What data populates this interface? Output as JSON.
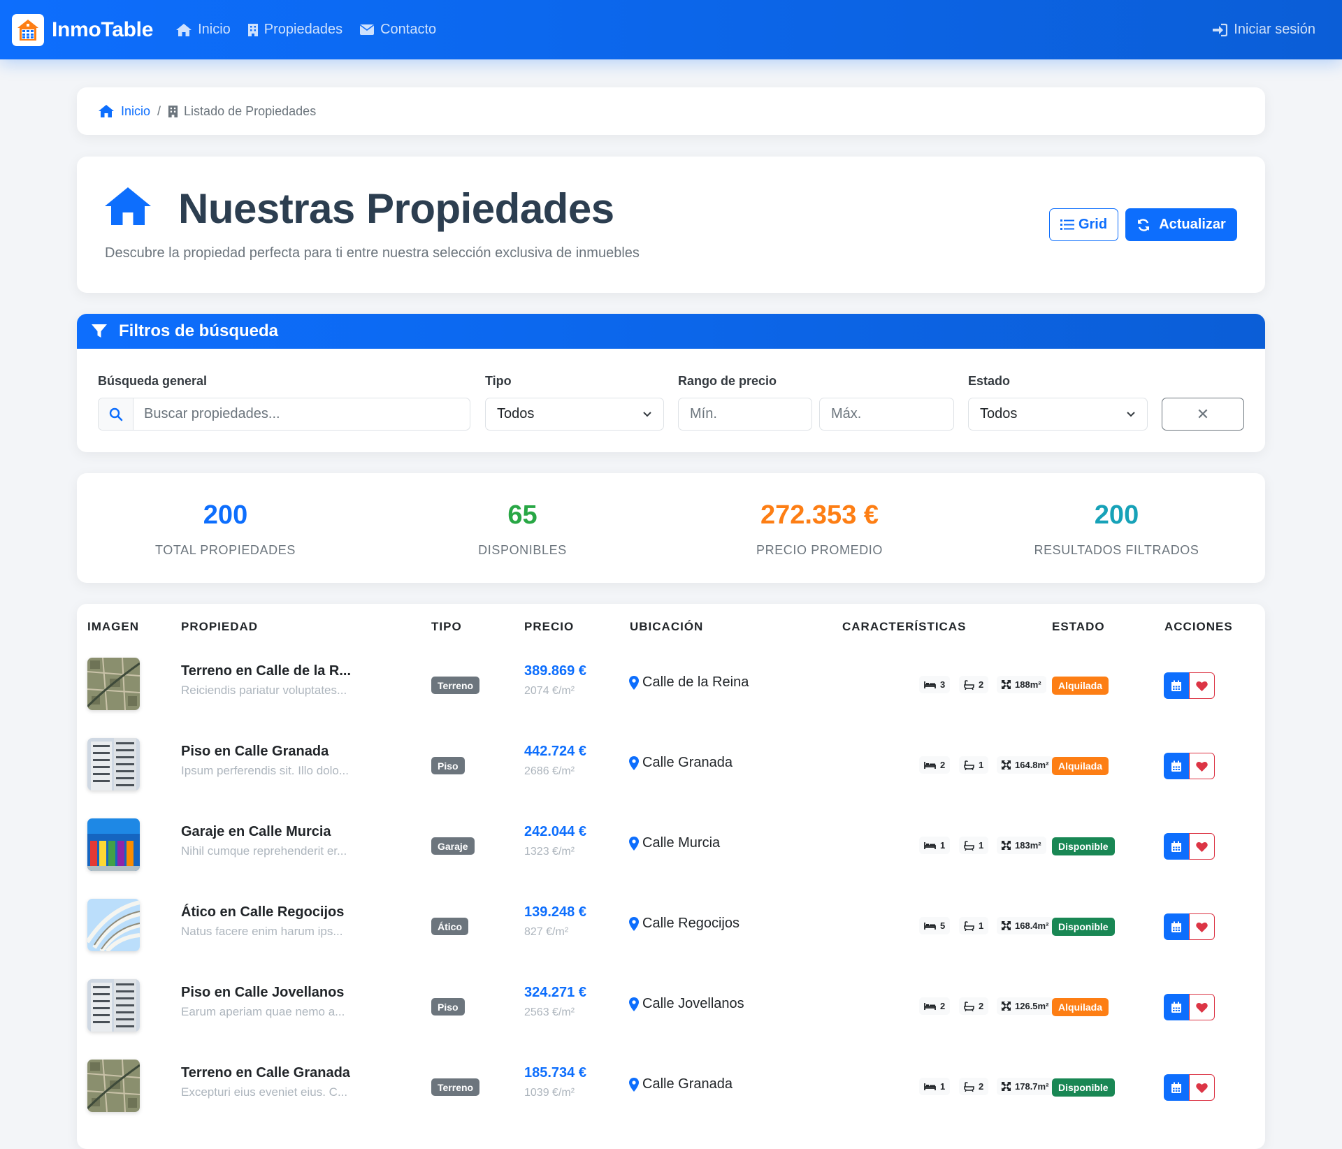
{
  "nav": {
    "brand": "InmoTable",
    "links": [
      "Inicio",
      "Propiedades",
      "Contacto"
    ],
    "login": "Iniciar sesión"
  },
  "breadcrumb": {
    "home": "Inicio",
    "separator": "/",
    "current": "Listado de Propiedades"
  },
  "header": {
    "title": "Nuestras Propiedades",
    "subtitle": "Descubre la propiedad perfecta para ti entre nuestra selección exclusiva de inmuebles",
    "grid_button": "Grid",
    "refresh_button": "Actualizar"
  },
  "filters": {
    "title": "Filtros de búsqueda",
    "search_label": "Búsqueda general",
    "search_placeholder": "Buscar propiedades...",
    "type_label": "Tipo",
    "type_value": "Todos",
    "price_label": "Rango de precio",
    "price_min_placeholder": "Mín.",
    "price_max_placeholder": "Máx.",
    "status_label": "Estado",
    "status_value": "Todos",
    "clear_symbol": "✕"
  },
  "stats": [
    {
      "value": "200",
      "label": "TOTAL PROPIEDADES",
      "color": "#0d6efd"
    },
    {
      "value": "65",
      "label": "DISPONIBLES",
      "color": "#28a745"
    },
    {
      "value": "272.353 €",
      "label": "PRECIO PROMEDIO",
      "color": "#fd7e14"
    },
    {
      "value": "200",
      "label": "RESULTADOS FILTRADOS",
      "color": "#17a2b8"
    }
  ],
  "table": {
    "columns": [
      "IMAGEN",
      "PROPIEDAD",
      "TIPO",
      "PRECIO",
      "UBICACIÓN",
      "CARACTERÍSTICAS",
      "ESTADO",
      "ACCIONES"
    ],
    "rows": [
      {
        "image": "aerial-land",
        "title": "Terreno en Calle de la R...",
        "desc": "Reiciendis pariatur voluptates...",
        "type": "Terreno",
        "price": "389.869 €",
        "ppm": "2074 €/m²",
        "location": "Calle de la Reina",
        "beds": "3",
        "baths": "2",
        "area": "188m²",
        "status": "Alquilada",
        "status_color": "orange"
      },
      {
        "image": "apartment-building",
        "title": "Piso en Calle Granada",
        "desc": "Ipsum perferendis sit. Illo dolo...",
        "type": "Piso",
        "price": "442.724 €",
        "ppm": "2686 €/m²",
        "location": "Calle Granada",
        "beds": "2",
        "baths": "1",
        "area": "164.8m²",
        "status": "Alquilada",
        "status_color": "orange"
      },
      {
        "image": "colorful-garage-doors",
        "title": "Garaje en Calle Murcia",
        "desc": "Nihil cumque reprehenderit er...",
        "type": "Garaje",
        "price": "242.044 €",
        "ppm": "1323 €/m²",
        "location": "Calle Murcia",
        "beds": "1",
        "baths": "1",
        "area": "183m²",
        "status": "Disponible",
        "status_color": "green"
      },
      {
        "image": "curved-balconies",
        "title": "Ático en Calle Regocijos",
        "desc": "Natus facere enim harum ips...",
        "type": "Ático",
        "price": "139.248 €",
        "ppm": "827 €/m²",
        "location": "Calle Regocijos",
        "beds": "5",
        "baths": "1",
        "area": "168.4m²",
        "status": "Disponible",
        "status_color": "green"
      },
      {
        "image": "apartment-building",
        "title": "Piso en Calle Jovellanos",
        "desc": "Earum aperiam quae nemo a...",
        "type": "Piso",
        "price": "324.271 €",
        "ppm": "2563 €/m²",
        "location": "Calle Jovellanos",
        "beds": "2",
        "baths": "2",
        "area": "126.5m²",
        "status": "Alquilada",
        "status_color": "orange"
      },
      {
        "image": "aerial-land",
        "title": "Terreno en Calle Granada",
        "desc": "Excepturi eius eveniet eius. C...",
        "type": "Terreno",
        "price": "185.734 €",
        "ppm": "1039 €/m²",
        "location": "Calle Granada",
        "beds": "1",
        "baths": "2",
        "area": "178.7m²",
        "status": "Disponible",
        "status_color": "green"
      }
    ]
  }
}
